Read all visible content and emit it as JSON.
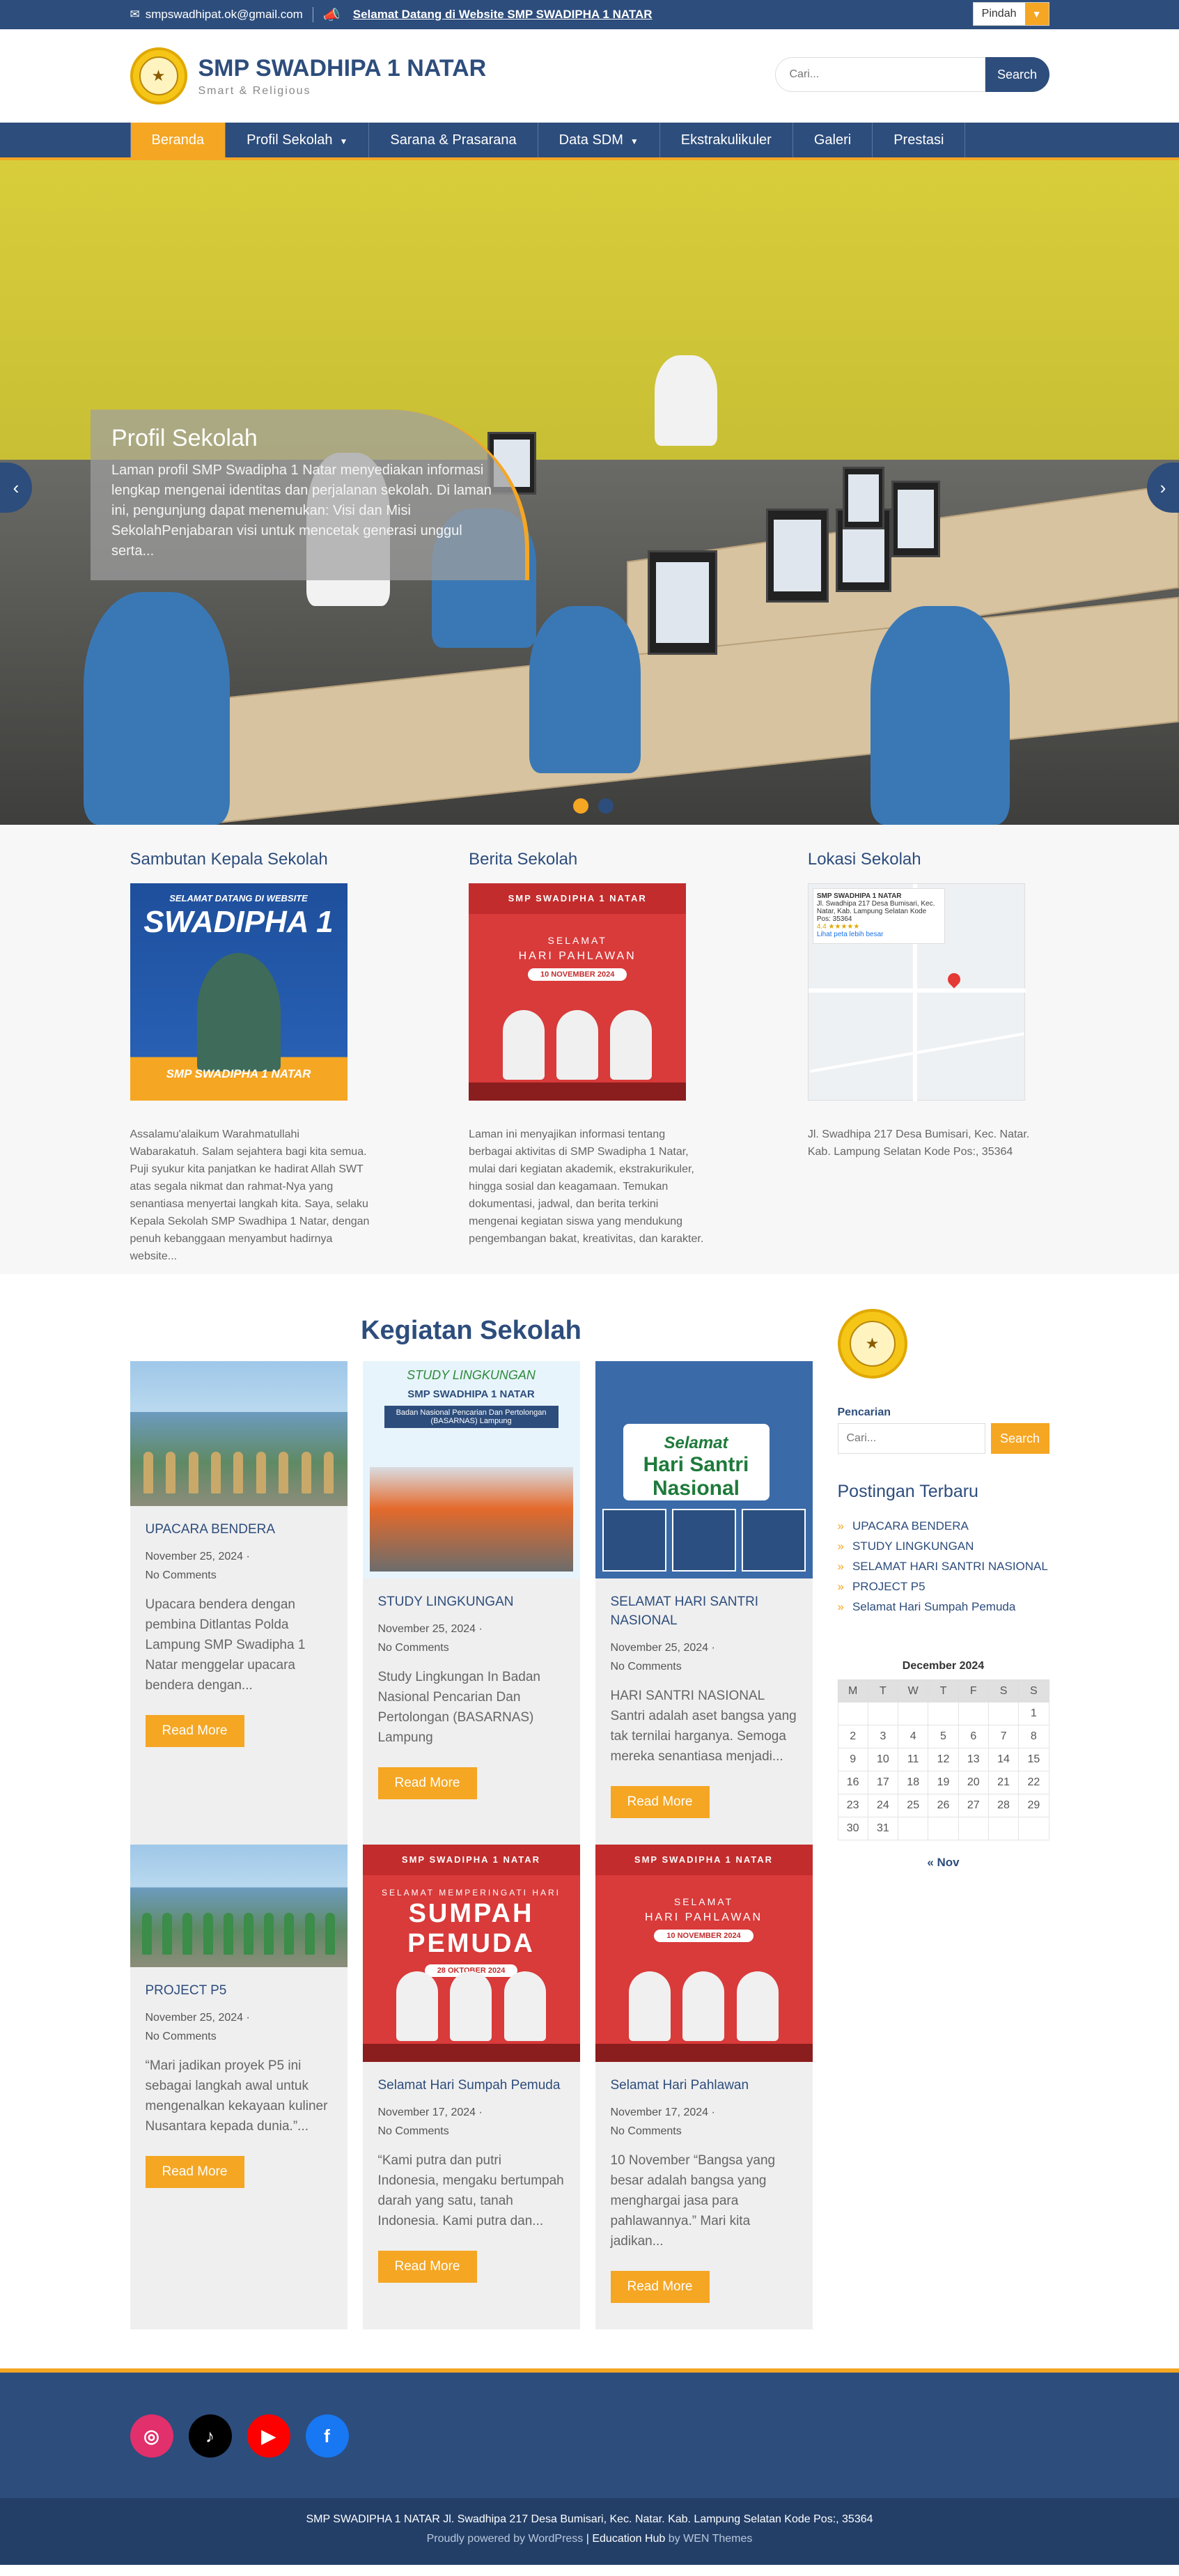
{
  "topbar": {
    "email": "smpswadhipat.ok@gmail.com",
    "announcement": "Selamat Datang di Website SMP SWADIPHA 1 NATAR",
    "language_label": "Pindah"
  },
  "header": {
    "site_name": "SMP SWADHIPA 1 NATAR",
    "tagline": "Smart & Religious",
    "search_placeholder": "Cari...",
    "search_button": "Search"
  },
  "nav": {
    "items": [
      {
        "label": "Beranda"
      },
      {
        "label": "Profil Sekolah"
      },
      {
        "label": "Sarana & Prasarana"
      },
      {
        "label": "Data SDM"
      },
      {
        "label": "Ekstrakulikuler"
      },
      {
        "label": "Galeri"
      },
      {
        "label": "Prestasi"
      }
    ]
  },
  "hero": {
    "title": "Profil Sekolah",
    "text": "Laman profil SMP Swadipha 1 Natar menyediakan informasi lengkap mengenai identitas dan perjalanan sekolah. Di laman ini, pengunjung dapat menemukan: Visi dan Misi SekolahPenjabaran visi untuk mencetak generasi unggul serta..."
  },
  "sections": {
    "sambutan": {
      "title": "Sambutan Kepala Sekolah",
      "text": "Assalamu'alaikum Warahmatullahi Wabarakatuh. Salam sejahtera bagi kita semua. Puji syukur kita panjatkan ke hadirat Allah SWT atas segala nikmat dan rahmat-Nya yang senantiasa menyertai langkah kita. Saya, selaku Kepala Sekolah SMP Swadhipa 1 Natar, dengan penuh kebanggaan menyambut hadirnya website...",
      "poster_top": "SELAMAT DATANG DI WEBSITE",
      "poster_big": "SWADIPHA 1",
      "poster_band": "SMP SWADIPHA 1 NATAR"
    },
    "berita": {
      "title": "Berita Sekolah",
      "text": "Laman ini menyajikan informasi tentang berbagai aktivitas di SMP Swadipha 1 Natar, mulai dari kegiatan akademik, ekstrakurikuler, hingga sosial dan keagamaan. Temukan dokumentasi, jadwal, dan berita terkini mengenai kegiatan siswa yang mendukung pengembangan bakat, kreativitas, dan karakter.",
      "poster_top": "SMP SWADIPHA 1 NATAR",
      "poster_sel": "SELAMAT",
      "poster_big": "HARI PAHLAWAN",
      "poster_date": "10 NOVEMBER 2024"
    },
    "lokasi": {
      "title": "Lokasi Sekolah",
      "text": "Jl. Swadhipa 217 Desa Bumisari, Kec. Natar. Kab. Lampung Selatan Kode Pos:, 35364",
      "map_name": "SMP SWADHIPA 1 NATAR",
      "map_addr": "Jl. Swadhipa 217 Desa Bumisari, Kec. Natar, Kab. Lampung Selatan Kode Pos: 35364",
      "map_rating": "4.4 ★★★★★",
      "map_link": "Lihat peta lebih besar"
    }
  },
  "kegiatan": {
    "title": "Kegiatan Sekolah",
    "read_more": "Read More",
    "posts": [
      {
        "title": "UPACARA BENDERA",
        "date": "November 25, 2024",
        "comments": "No Comments",
        "excerpt": "Upacara bendera dengan pembina Ditlantas Polda Lampung SMP Swadipha 1 Natar menggelar upacara bendera dengan..."
      },
      {
        "title": "STUDY LINGKUNGAN",
        "date": "November 25, 2024",
        "comments": "No Comments",
        "excerpt": "Study Lingkungan In Badan Nasional Pencarian Dan Pertolongan (BASARNAS) Lampung",
        "img_title": "STUDY LINGKUNGAN",
        "img_sub": "SMP SWADHIPA 1 NATAR",
        "img_box": "Badan Nasional Pencarian Dan Pertolongan (BASARNAS) Lampung"
      },
      {
        "title": "SELAMAT HARI SANTRI NASIONAL",
        "date": "November 25, 2024",
        "comments": "No Comments",
        "excerpt": "HARI SANTRI NASIONAL Santri adalah aset bangsa yang tak ternilai harganya. Semoga mereka senantiasa menjadi...",
        "img_s": "Selamat",
        "img_n": "Hari Santri Nasional"
      },
      {
        "title": "PROJECT P5",
        "date": "November 25, 2024",
        "comments": "No Comments",
        "excerpt": "“Mari jadikan proyek P5 ini sebagai langkah awal untuk mengenalkan kekayaan kuliner Nusantara kepada dunia.”..."
      },
      {
        "title": "Selamat Hari Sumpah Pemuda",
        "date": "November 17, 2024",
        "comments": "No Comments",
        "excerpt": "“Kami putra dan putri Indonesia, mengaku bertumpah darah yang satu, tanah Indonesia. Kami putra dan...",
        "img_top": "SMP SWADIPHA 1 NATAR",
        "img_sel": "SELAMAT MEMPERINGATI HARI",
        "img_big": "SUMPAH PEMUDA",
        "img_date": "28 OKTOBER 2024"
      },
      {
        "title": "Selamat Hari Pahlawan",
        "date": "November 17, 2024",
        "comments": "No Comments",
        "excerpt": "10 November “Bangsa yang besar adalah bangsa yang menghargai jasa para pahlawannya.” Mari kita jadikan...",
        "img_top": "SMP SWADIPHA 1 NATAR",
        "img_sel": "SELAMAT",
        "img_big": "HARI PAHLAWAN",
        "img_date": "10 NOVEMBER 2024"
      }
    ]
  },
  "sidebar": {
    "search_label": "Pencarian",
    "search_placeholder": "Cari...",
    "search_button": "Search",
    "recent_title": "Postingan Terbaru",
    "recent": [
      "UPACARA BENDERA",
      "STUDY LINGKUNGAN",
      "SELAMAT HARI SANTRI NASIONAL",
      "PROJECT P5",
      "Selamat Hari Sumpah Pemuda"
    ],
    "calendar": {
      "caption": "December 2024",
      "days": [
        "M",
        "T",
        "W",
        "T",
        "F",
        "S",
        "S"
      ],
      "weeks": [
        [
          "",
          "",
          "",
          "",
          "",
          "",
          "1"
        ],
        [
          "2",
          "3",
          "4",
          "5",
          "6",
          "7",
          "8"
        ],
        [
          "9",
          "10",
          "11",
          "12",
          "13",
          "14",
          "15"
        ],
        [
          "16",
          "17",
          "18",
          "19",
          "20",
          "21",
          "22"
        ],
        [
          "23",
          "24",
          "25",
          "26",
          "27",
          "28",
          "29"
        ],
        [
          "30",
          "31",
          "",
          "",
          "",
          "",
          ""
        ]
      ],
      "prev": "« Nov"
    }
  },
  "footer": {
    "address": "SMP SWADIPHA 1 NATAR Jl. Swadhipa 217 Desa Bumisari, Kec. Natar. Kab. Lampung Selatan Kode Pos:, 35364",
    "powered": "Proudly powered by WordPress",
    "theme_name": "Education Hub",
    "theme_by": "WEN Themes"
  }
}
